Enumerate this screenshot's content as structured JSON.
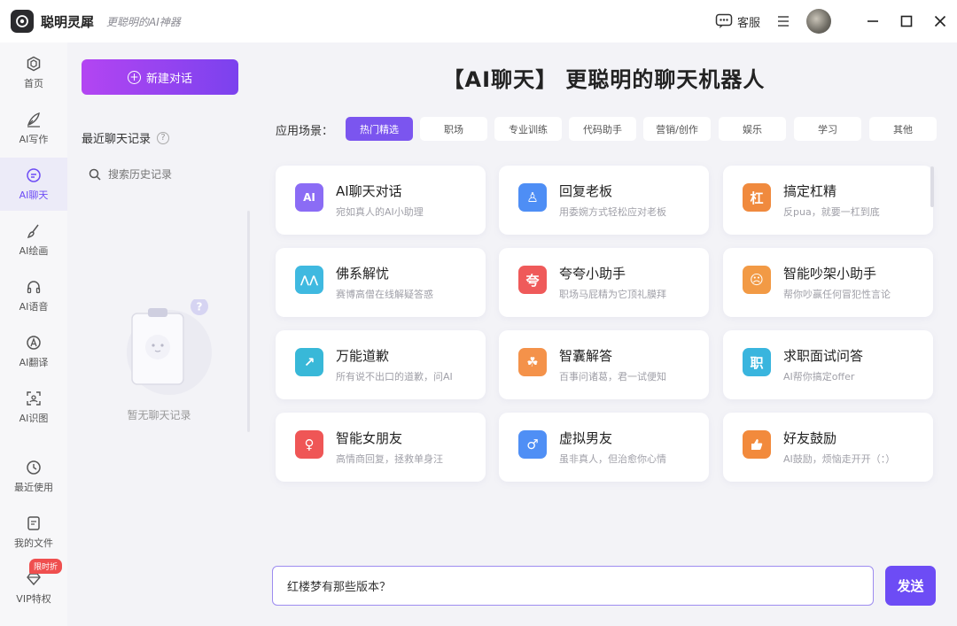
{
  "app": {
    "name": "聪明灵犀",
    "slogan": "更聪明的AI神器"
  },
  "titlebar": {
    "support_label": "客服"
  },
  "rail": {
    "items": [
      {
        "label": "首页",
        "icon": "home-icon"
      },
      {
        "label": "AI写作",
        "icon": "pen-icon"
      },
      {
        "label": "AI聊天",
        "icon": "chat-icon",
        "active": true
      },
      {
        "label": "AI绘画",
        "icon": "brush-icon"
      },
      {
        "label": "AI语音",
        "icon": "headphones-icon"
      },
      {
        "label": "AI翻译",
        "icon": "translate-icon"
      },
      {
        "label": "AI识图",
        "icon": "image-scan-icon"
      },
      {
        "label": "最近使用",
        "icon": "history-icon"
      },
      {
        "label": "我的文件",
        "icon": "file-icon"
      },
      {
        "label": "VIP特权",
        "icon": "diamond-icon"
      }
    ],
    "vip_badge": "限时折"
  },
  "history": {
    "new_chat_label": "新建对话",
    "title": "最近聊天记录",
    "search_placeholder": "搜索历史记录",
    "empty_text": "暂无聊天记录"
  },
  "main": {
    "headline": "【AI聊天】 更聪明的聊天机器人",
    "scene_label": "应用场景：",
    "chips": [
      "热门精选",
      "职场",
      "专业训练",
      "代码助手",
      "营销/创作",
      "娱乐",
      "学习",
      "其他"
    ],
    "active_chip": 0,
    "cards": [
      {
        "title": "AI聊天对话",
        "desc": "宛如真人的AI小助理",
        "icon": "ai-chat-icon",
        "color": "#8b6cf5",
        "glyph": "AI"
      },
      {
        "title": "回复老板",
        "desc": "用委婉方式轻松应对老板",
        "icon": "boss-icon",
        "color": "#4e8ef5",
        "glyph": "♙"
      },
      {
        "title": "搞定杠精",
        "desc": "反pua，就要一杠到底",
        "icon": "bar-icon",
        "color": "#f08a3e",
        "glyph": "杠"
      },
      {
        "title": "佛系解忧",
        "desc": "赛博高僧在线解疑答惑",
        "icon": "buddha-icon",
        "color": "#3fb9e0",
        "glyph": "⋀⋀"
      },
      {
        "title": "夸夸小助手",
        "desc": "职场马屁精为它顶礼膜拜",
        "icon": "praise-icon",
        "color": "#ef5a5a",
        "glyph": "夸"
      },
      {
        "title": "智能吵架小助手",
        "desc": "帮你吵赢任何冒犯性言论",
        "icon": "angry-face-icon",
        "color": "#f29a45",
        "glyph": "☹"
      },
      {
        "title": "万能道歉",
        "desc": "所有说不出口的道歉，问AI",
        "icon": "apology-icon",
        "color": "#38b8d8",
        "glyph": "↗"
      },
      {
        "title": "智囊解答",
        "desc": "百事问诸葛，君一试便知",
        "icon": "bag-icon",
        "color": "#f4924a",
        "glyph": "☘"
      },
      {
        "title": "求职面试问答",
        "desc": "AI帮你搞定offer",
        "icon": "job-icon",
        "color": "#39b5de",
        "glyph": "职"
      },
      {
        "title": "智能女朋友",
        "desc": "高情商回复，拯救单身汪",
        "icon": "girlfriend-icon",
        "color": "#ef5656",
        "glyph": "♀"
      },
      {
        "title": "虚拟男友",
        "desc": "虽非真人，但治愈你心情",
        "icon": "boyfriend-icon",
        "color": "#4f8ff5",
        "glyph": "♂"
      },
      {
        "title": "好友鼓励",
        "desc": "AI鼓励，烦恼走开开（：）",
        "icon": "thumbs-up-icon",
        "color": "#f28a3c",
        "glyph": "👍"
      }
    ],
    "input_value": "红楼梦有那些版本？",
    "send_label": "发送"
  },
  "colors": {
    "accent": "#6d4cf5",
    "gradient_start": "#b345f2",
    "gradient_end": "#7b42ee"
  }
}
